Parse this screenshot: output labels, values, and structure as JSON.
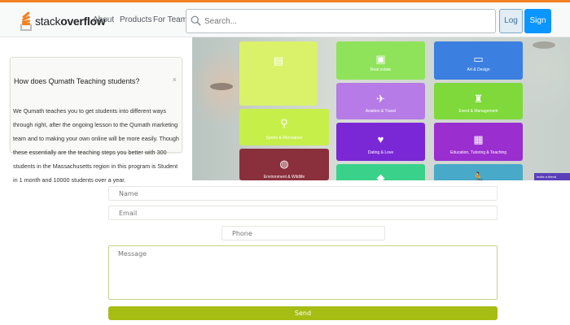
{
  "app": {
    "logo_light": "stack",
    "logo_bold": "overflow",
    "nav": [
      "About",
      "Products",
      "For Teams"
    ],
    "search_placeholder": "Search...",
    "login_label": "Log in",
    "signup_label": "Sign up",
    "accent": "#f48024",
    "primary": "#0a95ff"
  },
  "question": {
    "title": "How does Qumath Teaching students?",
    "close_glyph": "×",
    "body": "We Qumath teaches you to get students into different ways through right, after the ongoing lesson to the Qumath marketing team and to making your own online will be more easily. Though these essentially are the teaching steps you better with 300 students in the Massachusetts region in this program is Student in 1 month and 10000 students over a year."
  },
  "categories": [
    {
      "label": "",
      "icon": "document-icon",
      "color": "#d9f26a"
    },
    {
      "label": "Real estate",
      "icon": "image-icon",
      "color": "#8fe35a"
    },
    {
      "label": "Art & Design",
      "icon": "monitor-icon",
      "color": "#3b7fe0"
    },
    {
      "label": "Sports & Recreation",
      "icon": "sport-icon",
      "color": "#c7ef4a"
    },
    {
      "label": "Aviation & Travel",
      "icon": "plane-icon",
      "color": "#b67be6"
    },
    {
      "label": "Event & Management",
      "icon": "event-icon",
      "color": "#7fd93a"
    },
    {
      "label": "Environment & Wildlife",
      "icon": "globe-icon",
      "color": "#8a2f3c"
    },
    {
      "label": "Dating & Love",
      "icon": "hearts-icon",
      "color": "#7a28d6"
    },
    {
      "label": "Education, Tutoring & Teaching",
      "icon": "education-icon",
      "color": "#9a2ecf"
    },
    {
      "label": "",
      "icon": "diamond-icon",
      "color": "#3ad18a"
    },
    {
      "label": "",
      "icon": "runner-icon",
      "color": "#48a9c8"
    }
  ],
  "badge_text": "Invite a friend",
  "form": {
    "name_placeholder": "Name",
    "email_placeholder": "Email",
    "phone_placeholder": "Phone",
    "message_placeholder": "Message",
    "send_label": "Send",
    "send_color": "#a6bd13"
  }
}
